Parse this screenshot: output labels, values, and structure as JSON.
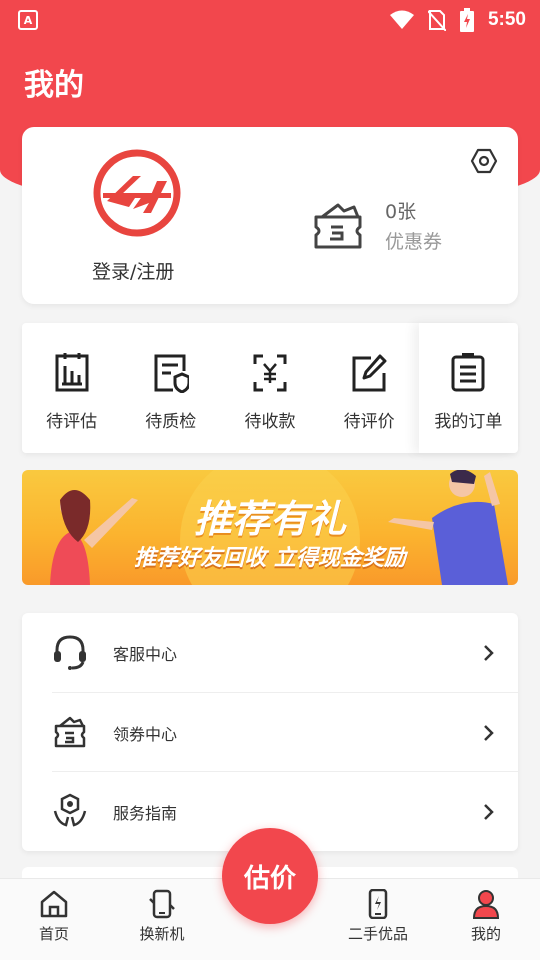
{
  "status_bar": {
    "app_badge": "A",
    "time": "5:50"
  },
  "header": {
    "title": "我的"
  },
  "profile": {
    "login_label": "登录/注册",
    "coupon_count": "0张",
    "coupon_label": "优惠券"
  },
  "orders": [
    {
      "label": "待评估",
      "icon": "report-icon"
    },
    {
      "label": "待质检",
      "icon": "inspect-icon"
    },
    {
      "label": "待收款",
      "icon": "payment-icon"
    },
    {
      "label": "待评价",
      "icon": "review-icon"
    },
    {
      "label": "我的订单",
      "icon": "orders-icon"
    }
  ],
  "banner": {
    "title": "推荐有礼",
    "subtitle": "推荐好友回收 立得现金奖励"
  },
  "menu": [
    {
      "label": "客服中心",
      "icon": "headset-icon"
    },
    {
      "label": "领券中心",
      "icon": "wallet-icon"
    },
    {
      "label": "服务指南",
      "icon": "guide-icon"
    }
  ],
  "bottom_nav": {
    "items": [
      {
        "label": "首页",
        "icon": "home-icon"
      },
      {
        "label": "换新机",
        "icon": "swap-phone-icon"
      },
      {
        "label": "二手优品",
        "icon": "phone-icon"
      },
      {
        "label": "我的",
        "icon": "user-icon"
      }
    ],
    "fab_label": "估价"
  },
  "colors": {
    "accent": "#f2474d",
    "banner": "#fbb42f"
  }
}
